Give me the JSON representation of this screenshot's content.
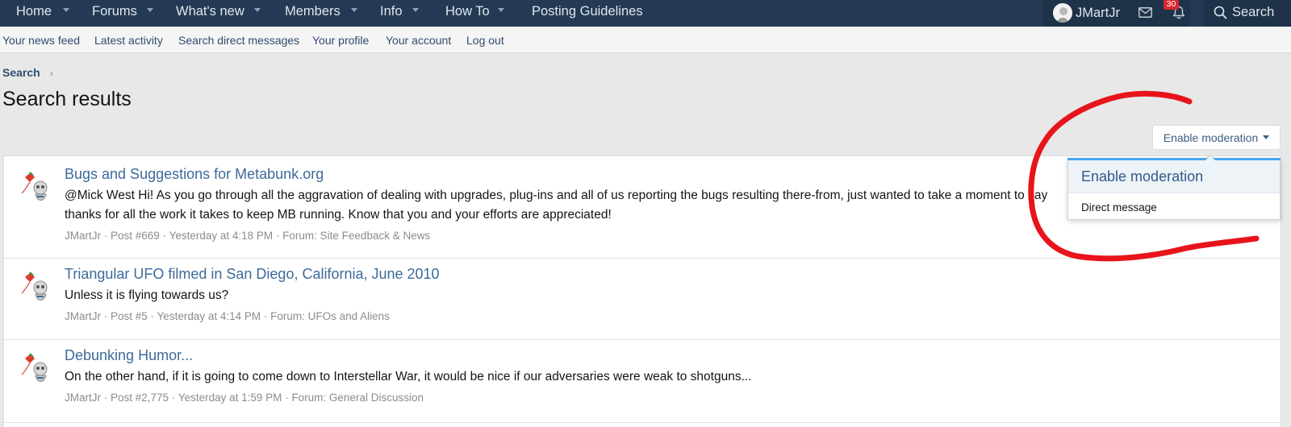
{
  "topnav": {
    "items": [
      {
        "label": "Home"
      },
      {
        "label": "Forums"
      },
      {
        "label": "What's new"
      },
      {
        "label": "Members"
      },
      {
        "label": "Info"
      },
      {
        "label": "How To"
      },
      {
        "label": "Posting Guidelines"
      }
    ],
    "username": "JMartJr",
    "alerts_count": "30",
    "search_label": "Search"
  },
  "subnav": {
    "items": [
      {
        "label": "Your news feed"
      },
      {
        "label": "Latest activity"
      },
      {
        "label": "Search direct messages"
      },
      {
        "label": "Your profile"
      },
      {
        "label": "Your account"
      },
      {
        "label": "Log out"
      }
    ]
  },
  "breadcrumb": {
    "item": "Search"
  },
  "page_title": "Search results",
  "moderation_button": "Enable moderation",
  "dropdown": {
    "header": "Enable moderation",
    "item": "Direct message"
  },
  "results": [
    {
      "title": "Bugs and Suggestions for Metabunk.org",
      "snippet": "@Mick West Hi! As you go through all the aggravation of dealing with upgrades, plug-ins and all of us reporting the bugs resulting there-from, just wanted to take a moment to say thanks for all the work it takes to keep MB running. Know that you and your efforts are appreciated!",
      "author": "JMartJr",
      "post": "Post #669",
      "time": "Yesterday at 4:18 PM",
      "forum": "Forum: Site Feedback & News"
    },
    {
      "title": "Triangular UFO filmed in San Diego, California, June 2010",
      "snippet": "Unless it is flying towards us?",
      "author": "JMartJr",
      "post": "Post #5",
      "time": "Yesterday at 4:14 PM",
      "forum": "Forum: UFOs and Aliens"
    },
    {
      "title": "Debunking Humor...",
      "snippet": "On the other hand, if it is going to come down to Interstellar War, it would be nice if our adversaries were weak to shotguns...",
      "author": "JMartJr",
      "post": "Post #2,775",
      "time": "Yesterday at 1:59 PM",
      "forum": "Forum: General Discussion"
    }
  ],
  "colors": {
    "nav_bg": "#243a54",
    "link": "#3d6a9a",
    "annotation": "#e8141c",
    "badge": "#d9272e"
  }
}
